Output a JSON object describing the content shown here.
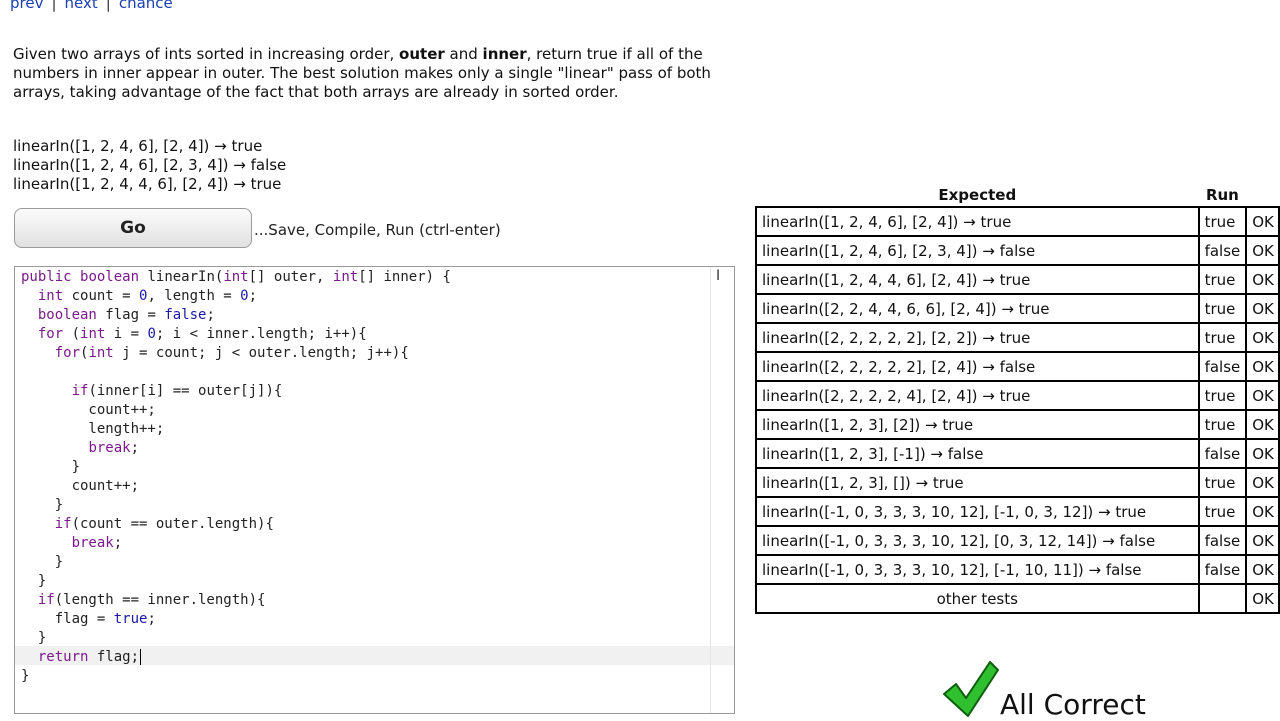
{
  "nav": {
    "prev": "prev",
    "next": "next",
    "chance": "chance",
    "separator": "|"
  },
  "description": {
    "part1": "Given two arrays of ints sorted in increasing order, ",
    "bold1": "outer",
    "part2": " and ",
    "bold2": "inner",
    "part3": ", return true if all of the numbers in inner appear in outer. The best solution makes only a single \"linear\" pass of both arrays, taking advantage of the fact that both arrays are already in sorted order."
  },
  "examples": [
    "linearIn([1, 2, 4, 6], [2, 4]) → true",
    "linearIn([1, 2, 4, 6], [2, 3, 4]) → false",
    "linearIn([1, 2, 4, 4, 6], [2, 4]) → true"
  ],
  "go": {
    "label": "Go",
    "hint": "...Save, Compile, Run (ctrl-enter)"
  },
  "code_lines": [
    "public boolean linearIn(int[] outer, int[] inner) {",
    "  int count = 0, length = 0;",
    "  boolean flag = false;",
    "  for (int i = 0; i < inner.length; i++){",
    "    for(int j = count; j < outer.length; j++){",
    "",
    "      if(inner[i] == outer[j]){",
    "        count++;",
    "        length++;",
    "        break;",
    "      }",
    "      count++;",
    "    }",
    "    if(count == outer.length){",
    "      break;",
    "    }",
    "  }",
    "  if(length == inner.length){",
    "    flag = true;",
    "  }",
    "  return flag;",
    "}"
  ],
  "results": {
    "header_expected": "Expected",
    "header_run": "Run",
    "rows": [
      {
        "expected": "linearIn([1, 2, 4, 6], [2, 4]) → true",
        "run": "true",
        "status": "OK"
      },
      {
        "expected": "linearIn([1, 2, 4, 6], [2, 3, 4]) → false",
        "run": "false",
        "status": "OK"
      },
      {
        "expected": "linearIn([1, 2, 4, 4, 6], [2, 4]) → true",
        "run": "true",
        "status": "OK"
      },
      {
        "expected": "linearIn([2, 2, 4, 4, 6, 6], [2, 4]) → true",
        "run": "true",
        "status": "OK"
      },
      {
        "expected": "linearIn([2, 2, 2, 2, 2], [2, 2]) → true",
        "run": "true",
        "status": "OK"
      },
      {
        "expected": "linearIn([2, 2, 2, 2, 2], [2, 4]) → false",
        "run": "false",
        "status": "OK"
      },
      {
        "expected": "linearIn([2, 2, 2, 2, 4], [2, 4]) → true",
        "run": "true",
        "status": "OK"
      },
      {
        "expected": "linearIn([1, 2, 3], [2]) → true",
        "run": "true",
        "status": "OK"
      },
      {
        "expected": "linearIn([1, 2, 3], [-1]) → false",
        "run": "false",
        "status": "OK"
      },
      {
        "expected": "linearIn([1, 2, 3], []) → true",
        "run": "true",
        "status": "OK"
      },
      {
        "expected": "linearIn([-1, 0, 3, 3, 3, 10, 12], [-1, 0, 3, 12]) → true",
        "run": "true",
        "status": "OK"
      },
      {
        "expected": "linearIn([-1, 0, 3, 3, 3, 10, 12], [0, 3, 12, 14]) → false",
        "run": "false",
        "status": "OK"
      },
      {
        "expected": "linearIn([-1, 0, 3, 3, 3, 10, 12], [-1, 10, 11]) → false",
        "run": "false",
        "status": "OK"
      }
    ],
    "other": {
      "label": "other tests",
      "run": "",
      "status": "OK"
    }
  },
  "summary": {
    "text": "All Correct",
    "icon": "checkmark-icon",
    "icon_color": "#2fbf2f"
  },
  "colors": {
    "link": "#1a3fb0",
    "keyword": "#7a1a8c",
    "literal": "#1a1aa6"
  }
}
